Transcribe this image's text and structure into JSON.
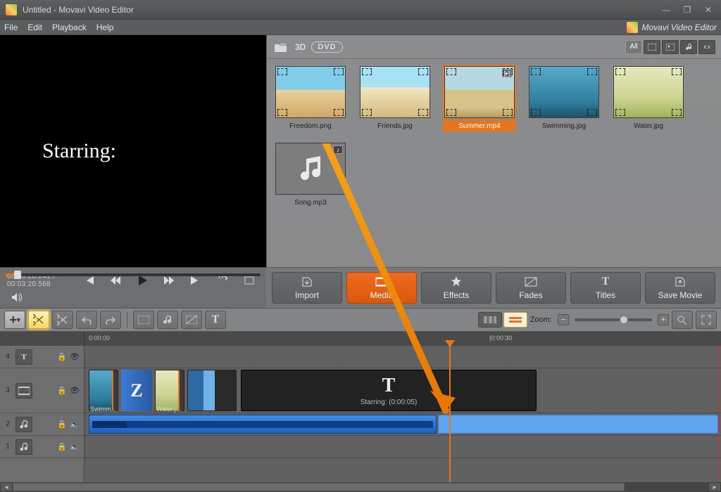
{
  "window": {
    "title": "Untitled - Movavi Video Editor"
  },
  "brand": "Movavi Video Editor",
  "menu": {
    "file": "File",
    "edit": "Edit",
    "playback": "Playback",
    "help": "Help"
  },
  "preview": {
    "overlay_text": "Starring:"
  },
  "transport": {
    "current": "00:00:28.241",
    "total": "00:03:20.568",
    "separator": " / "
  },
  "media_toolbar": {
    "three_d": "3D",
    "dvd": "DVD",
    "view_all": "All"
  },
  "media": [
    {
      "label": "Freedom.png",
      "kind": "image",
      "styleClass": "beach1"
    },
    {
      "label": "Friends.jpg",
      "kind": "image",
      "styleClass": "beach2"
    },
    {
      "label": "Summer.mp4",
      "kind": "video",
      "styleClass": "beach3",
      "selected": true
    },
    {
      "label": "Swimming.jpg",
      "kind": "image",
      "styleClass": "beach4"
    },
    {
      "label": "Water.jpg",
      "kind": "image",
      "styleClass": "beach5"
    },
    {
      "label": "Song.mp3",
      "kind": "audio"
    }
  ],
  "tabs": {
    "import": "Import",
    "media": "Media",
    "effects": "Effects",
    "fades": "Fades",
    "titles": "Titles",
    "save": "Save Movie"
  },
  "tl_toolbar": {
    "zoom_label": "Zoom:"
  },
  "ruler": {
    "t0": "0:00:00",
    "t1": "|0:00:30"
  },
  "tracks": {
    "r4": "4",
    "r3": "3",
    "r2": "2",
    "r1": "1"
  },
  "clips": {
    "swim_label": "Swimm...",
    "water_label": "Water.j...",
    "trans_glyph": "Z",
    "title_big": "T",
    "title_sub": "Starring: (0:00:05)"
  }
}
